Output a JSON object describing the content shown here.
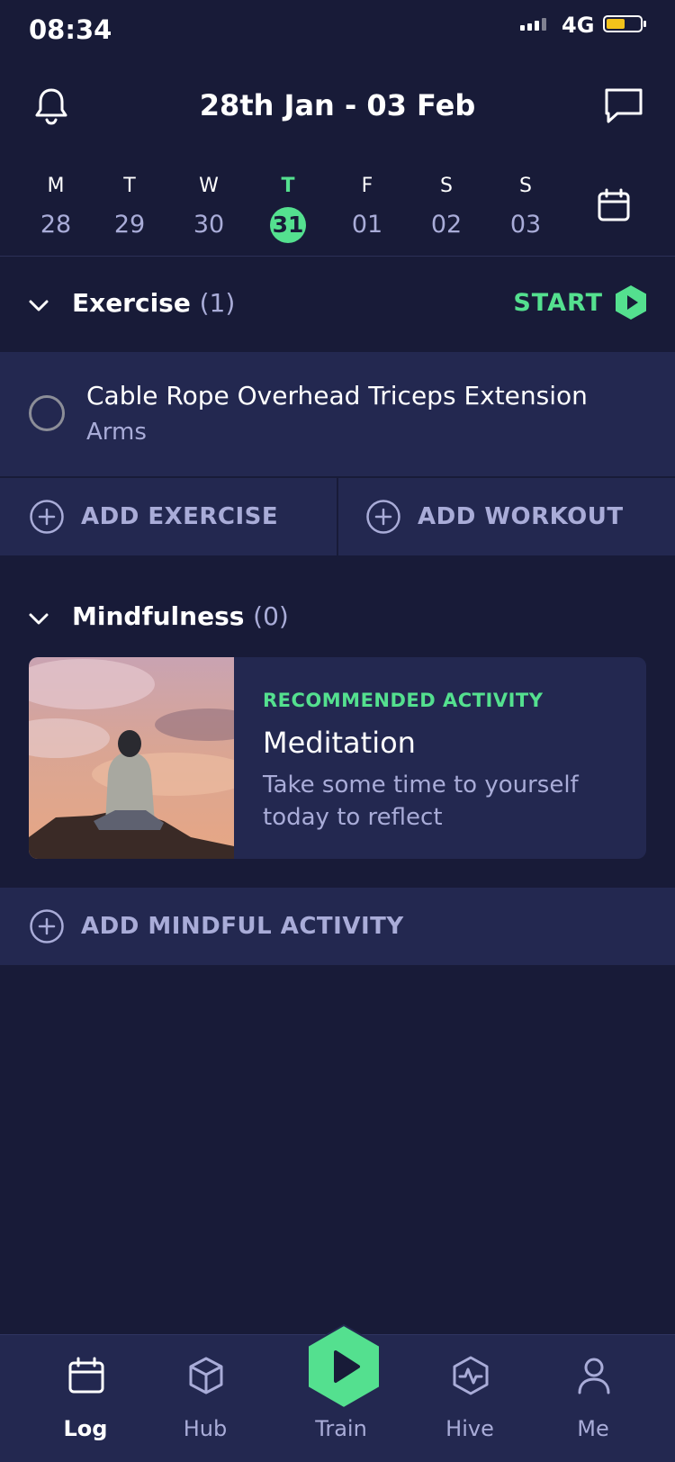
{
  "status_bar": {
    "time": "08:34",
    "network": "4G"
  },
  "header": {
    "title": "28th Jan - 03 Feb",
    "left_icon": "bell-icon",
    "right_icon": "chat-icon"
  },
  "week": {
    "days": [
      {
        "letter": "M",
        "num": "28"
      },
      {
        "letter": "T",
        "num": "29"
      },
      {
        "letter": "W",
        "num": "30"
      },
      {
        "letter": "T",
        "num": "31",
        "active": true
      },
      {
        "letter": "F",
        "num": "01"
      },
      {
        "letter": "S",
        "num": "02"
      },
      {
        "letter": "S",
        "num": "03"
      }
    ],
    "calendar_icon": "calendar-icon"
  },
  "exercise": {
    "title": "Exercise",
    "count": "(1)",
    "start_label": "START",
    "items": [
      {
        "name": "Cable Rope Overhead Triceps Extension",
        "category": "Arms"
      }
    ],
    "add_exercise": "ADD EXERCISE",
    "add_workout": "ADD WORKOUT"
  },
  "mindfulness": {
    "title": "Mindfulness",
    "count": "(0)",
    "card": {
      "kicker": "RECOMMENDED ACTIVITY",
      "title": "Meditation",
      "description": "Take some time to yourself today to reflect"
    },
    "add_mindful": "ADD MINDFUL ACTIVITY"
  },
  "tabs": [
    {
      "label": "Log",
      "icon": "calendar-icon",
      "active": true
    },
    {
      "label": "Hub",
      "icon": "cube-icon"
    },
    {
      "label": "Train",
      "icon": "play-icon"
    },
    {
      "label": "Hive",
      "icon": "activity-hex-icon"
    },
    {
      "label": "Me",
      "icon": "user-icon"
    }
  ],
  "colors": {
    "background": "#181b38",
    "surface": "#232850",
    "accent": "#54e08f",
    "muted": "#a9acd8"
  }
}
